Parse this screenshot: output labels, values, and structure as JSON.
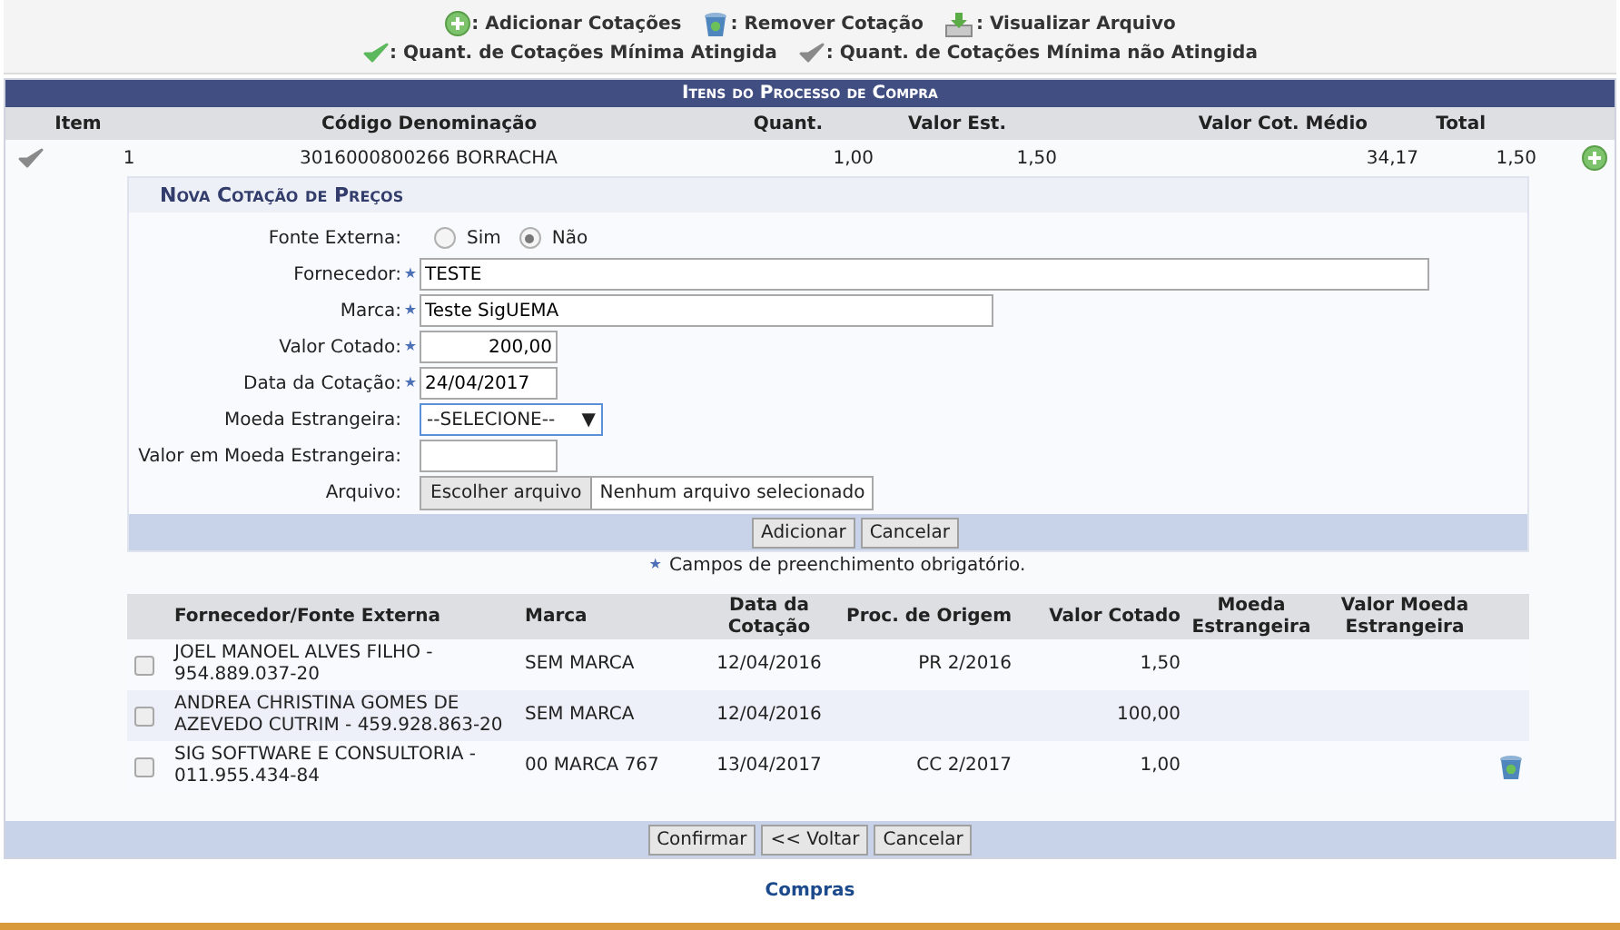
{
  "legend": [
    [
      {
        "kind": "add",
        "label": ": Adicionar Cotações"
      },
      {
        "kind": "remove",
        "label": ": Remover Cotação"
      },
      {
        "kind": "view",
        "label": ": Visualizar Arquivo"
      }
    ],
    [
      {
        "kind": "min_ok",
        "label": ": Quant. de Cotações Mínima Atingida"
      },
      {
        "kind": "min_not",
        "label": ": Quant. de Cotações Mínima não Atingida"
      }
    ]
  ],
  "items_table": {
    "title": "Itens do Processo de Compra",
    "columns": [
      "Item",
      "Código Denominação",
      "Quant.",
      "Valor Est.",
      "Valor Cot. Médio",
      "Total"
    ],
    "rows": [
      {
        "min_reached": false,
        "cells": [
          "1",
          "3016000800266 BORRACHA",
          "1,00",
          "1,50",
          "34,17",
          "1,50"
        ]
      }
    ]
  },
  "required_mark": "★",
  "form": {
    "title": "Nova Cotação de Preços",
    "fields": [
      {
        "kind": "radio",
        "label": "Fonte Externa:",
        "options": [
          {
            "label": "Sim",
            "selected": false
          },
          {
            "label": "Não",
            "selected": true
          }
        ]
      },
      {
        "kind": "text_wide",
        "label": "Fornecedor:",
        "required": true,
        "value": "TESTE"
      },
      {
        "kind": "text_medium",
        "label": "Marca:",
        "required": true,
        "value": "Teste SigUEMA"
      },
      {
        "kind": "money",
        "label": "Valor Cotado:",
        "required": true,
        "value": "200,00"
      },
      {
        "kind": "date",
        "label": "Data da Cotação:",
        "required": true,
        "value": "24/04/2017"
      },
      {
        "kind": "select",
        "label": "Moeda Estrangeira:",
        "required": false,
        "value": "--SELECIONE--",
        "arrow": "▼"
      },
      {
        "kind": "money",
        "label": "Valor em Moeda Estrangeira:",
        "required": false
      },
      {
        "kind": "file",
        "label": "Arquivo:",
        "required": false,
        "button": "Escolher arquivo",
        "value": "Nenhum arquivo selecionado"
      }
    ],
    "buttons": [
      "Adicionar",
      "Cancelar"
    ],
    "note": "Campos de preenchimento obrigatório."
  },
  "quotes_table": {
    "columns": [
      "Fornecedor/Fonte Externa",
      "Marca",
      "Data da Cotação",
      "Proc. de Origem",
      "Valor Cotado",
      "Moeda Estrangeira",
      "Valor Moeda Estrangeira"
    ],
    "rows": [
      {
        "checked": false,
        "removable": false,
        "cells": [
          "JOEL MANOEL ALVES FILHO - 954.889.037-20",
          "SEM MARCA",
          "12/04/2016",
          "PR 2/2016",
          "1,50",
          "",
          ""
        ]
      },
      {
        "checked": false,
        "removable": false,
        "cells": [
          "ANDREA CHRISTINA GOMES DE AZEVEDO CUTRIM - 459.928.863-20",
          "SEM MARCA",
          "12/04/2016",
          "",
          "100,00",
          "",
          ""
        ]
      },
      {
        "checked": false,
        "removable": true,
        "cells": [
          "SIG SOFTWARE E CONSULTORIA - 011.955.434-84",
          "00 MARCA 767",
          "13/04/2017",
          "CC 2/2017",
          "1,00",
          "",
          ""
        ]
      }
    ]
  },
  "buttons": [
    "Confirmar",
    "<< Voltar",
    "Cancelar"
  ],
  "footer_link": "Compras"
}
